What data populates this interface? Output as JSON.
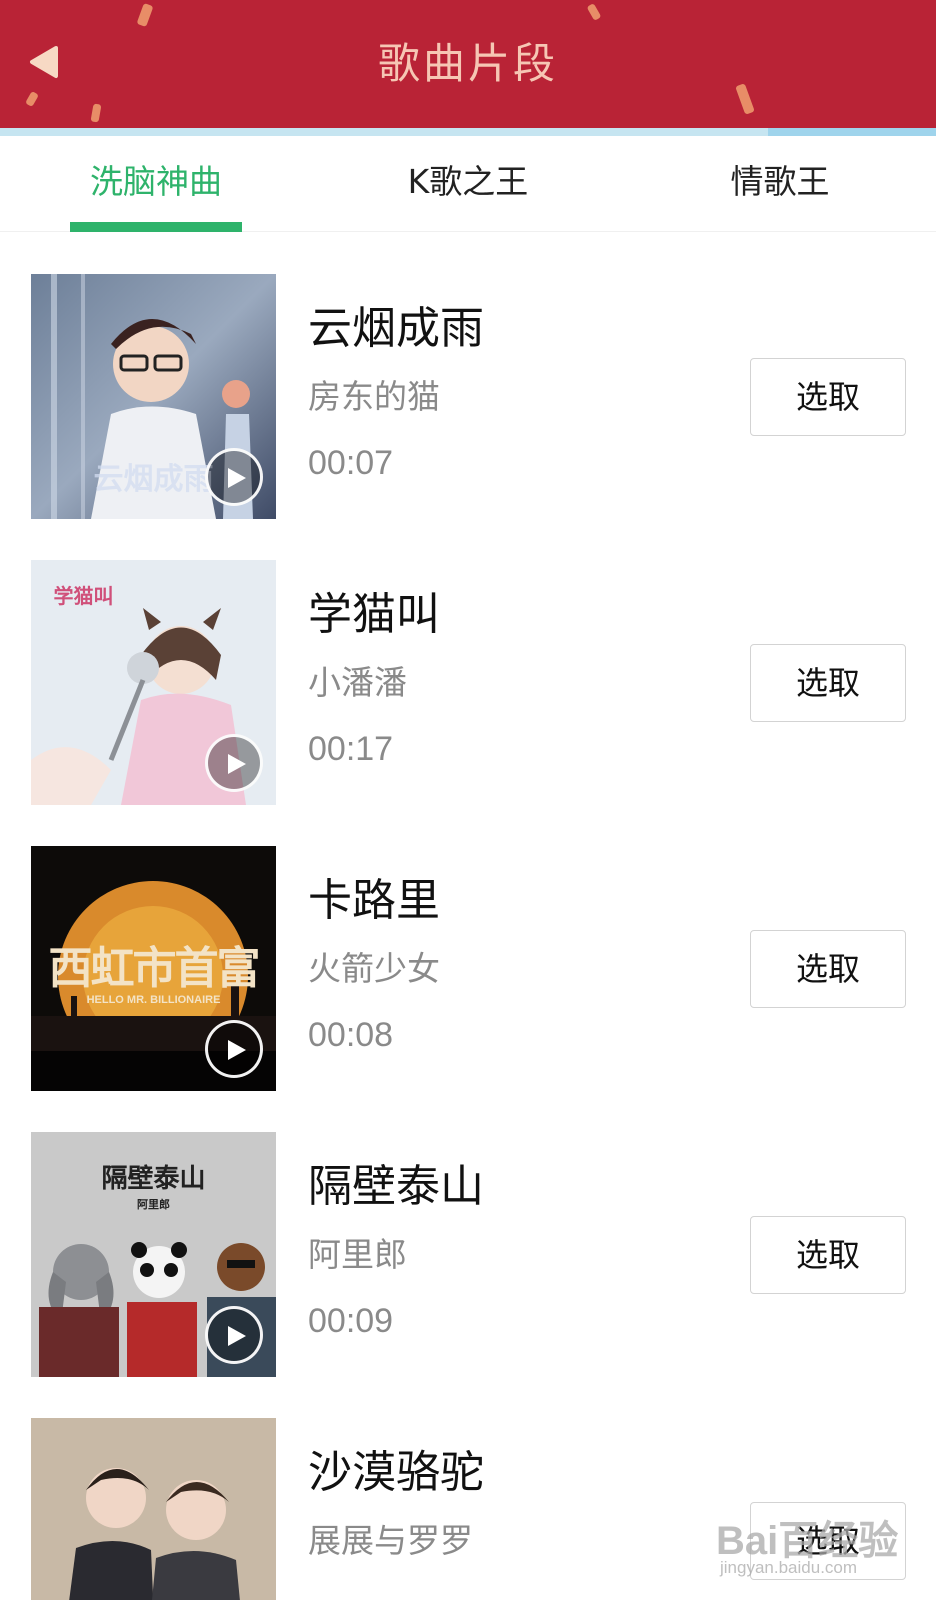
{
  "header": {
    "title": "歌曲片段",
    "back_icon": "back-arrow-icon",
    "background_color": "#b92336"
  },
  "tabs": [
    {
      "label": "洗脑神曲",
      "active": true
    },
    {
      "label": "K歌之王",
      "active": false
    },
    {
      "label": "情歌王",
      "active": false
    }
  ],
  "accent_color": "#2eb36b",
  "songs": [
    {
      "title": "云烟成雨",
      "artist": "房东的猫",
      "duration": "00:07",
      "action": "选取",
      "cover_text": "云烟成雨"
    },
    {
      "title": "学猫叫",
      "artist": "小潘潘",
      "duration": "00:17",
      "action": "选取",
      "cover_text": "学猫叫"
    },
    {
      "title": "卡路里",
      "artist": "火箭少女",
      "duration": "00:08",
      "action": "选取",
      "cover_text": "西虹市首富",
      "cover_subtext": "HELLO MR. BILLIONAIRE"
    },
    {
      "title": "隔壁泰山",
      "artist": "阿里郎",
      "duration": "00:09",
      "action": "选取",
      "cover_text": "隔壁泰山",
      "cover_subtext": "阿里郎"
    },
    {
      "title": "沙漠骆驼",
      "artist": "展展与罗罗",
      "duration": "",
      "action": "选取"
    }
  ],
  "watermark": {
    "main": "Bai百经验",
    "sub": "jingyan.baidu.com"
  }
}
